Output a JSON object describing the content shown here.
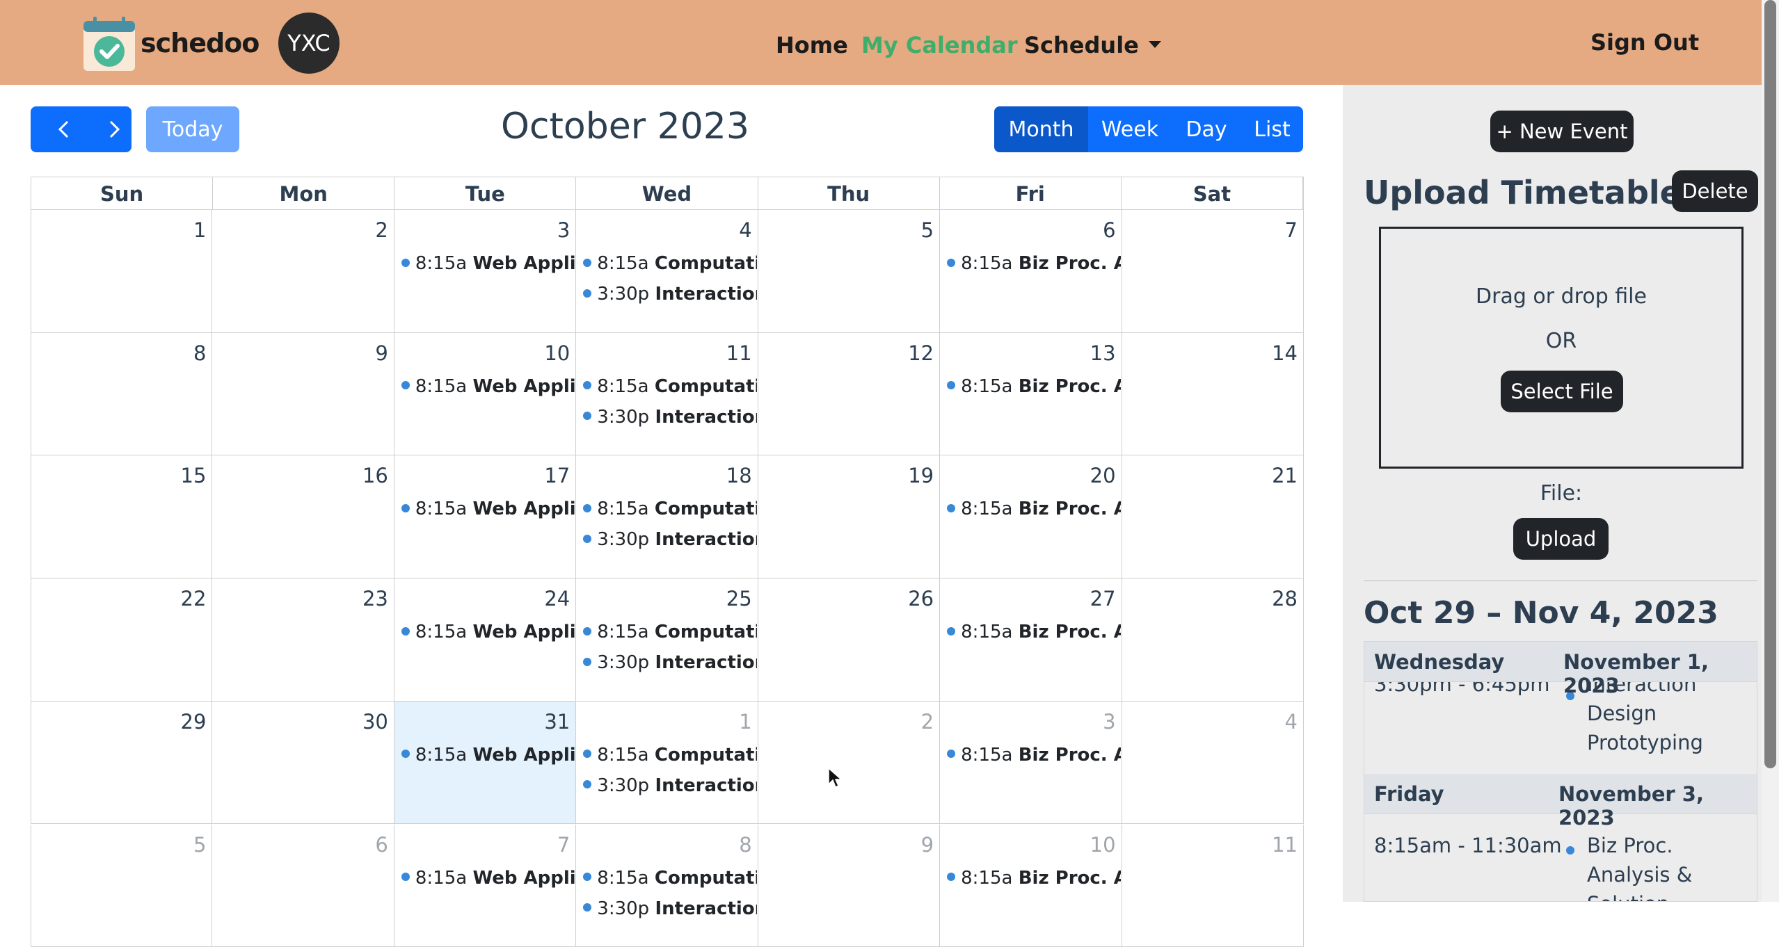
{
  "nav": {
    "logo_text": "schedoo",
    "avatar_initials": "YXC",
    "links": [
      "Home",
      "My Calendar",
      "Schedule"
    ],
    "sign_out": "Sign Out"
  },
  "toolbar": {
    "prev_icon": "chevron-left-icon",
    "next_icon": "chevron-right-icon",
    "today": "Today",
    "title": "October 2023",
    "views": [
      "Month",
      "Week",
      "Day",
      "List"
    ],
    "active_view": "Month"
  },
  "calendar": {
    "weekdays": [
      "Sun",
      "Mon",
      "Tue",
      "Wed",
      "Thu",
      "Fri",
      "Sat"
    ],
    "weeks": [
      [
        "1",
        "2",
        "3",
        "4",
        "5",
        "6",
        "7"
      ],
      [
        "8",
        "9",
        "10",
        "11",
        "12",
        "13",
        "14"
      ],
      [
        "15",
        "16",
        "17",
        "18",
        "19",
        "20",
        "21"
      ],
      [
        "22",
        "23",
        "24",
        "25",
        "26",
        "27",
        "28"
      ],
      [
        "29",
        "30",
        "31",
        "1",
        "2",
        "3",
        "4"
      ],
      [
        "5",
        "6",
        "7",
        "8",
        "9",
        "10",
        "11"
      ]
    ],
    "today": "31",
    "event_colors": {
      "dot": "#3788d8"
    },
    "events": {
      "tue": [
        {
          "time": "8:15a",
          "title": "Web Applicat"
        }
      ],
      "wed": [
        {
          "time": "8:15a",
          "title": "Computation"
        },
        {
          "time": "3:30p",
          "title": "Interaction D"
        }
      ],
      "fri": [
        {
          "time": "8:15a",
          "title": "Biz Proc. Anal"
        }
      ]
    }
  },
  "sidebar": {
    "new_event": "+ New Event",
    "upload_title": "Upload Timetable",
    "delete": "Delete",
    "drag_text": "Drag or drop file",
    "or_text": "OR",
    "select_file": "Select File",
    "file_label": "File:",
    "upload": "Upload",
    "range_title": "Oct 29 – Nov 4, 2023",
    "list": {
      "day1": {
        "weekday": "Wednesday",
        "date": "November 1, 2023",
        "time_partial": "3:30pm - 6:45pm",
        "event_lines": [
          "Interaction",
          "Design",
          "Prototyping"
        ]
      },
      "day2": {
        "weekday": "Friday",
        "date": "November 3, 2023",
        "time": "8:15am - 11:30am",
        "event_lines": [
          "Biz Proc.",
          "Analysis &",
          "Solution"
        ]
      }
    }
  }
}
